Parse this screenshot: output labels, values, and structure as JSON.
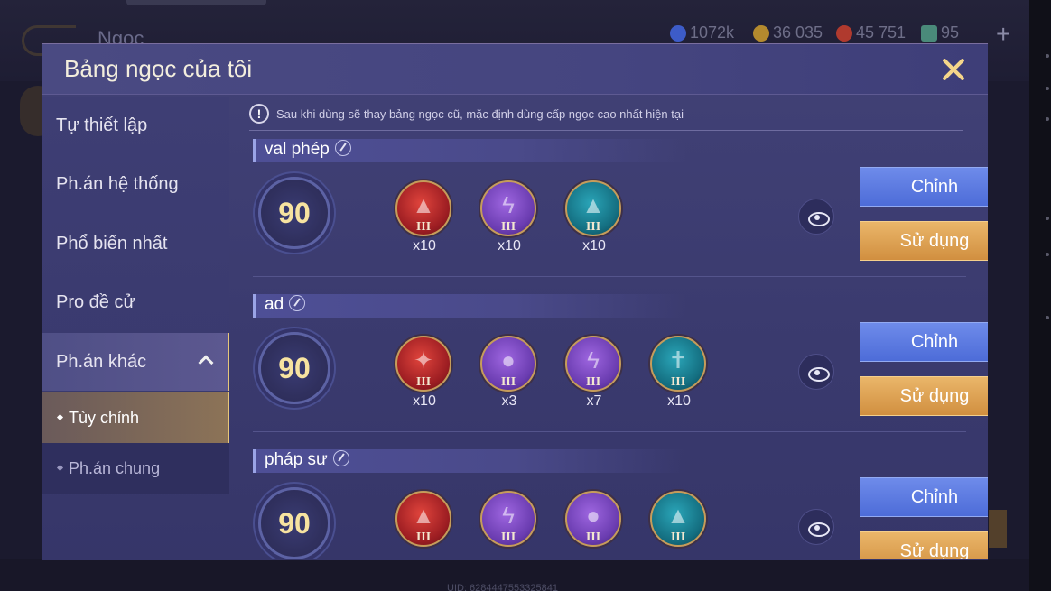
{
  "background": {
    "title": "Ngọc",
    "resources": [
      {
        "icon": "diamond-icon",
        "value": "1072k",
        "color": "#3d5cc8"
      },
      {
        "icon": "gold-coin-icon",
        "value": "36 035",
        "color": "#b48a2e"
      },
      {
        "icon": "ruby-icon",
        "value": "45 751",
        "color": "#b03a2e"
      },
      {
        "icon": "voucher-icon",
        "value": "95",
        "color": "#4a8a7a"
      }
    ],
    "plus_label": "+",
    "uid": "UID: 6284447553325841"
  },
  "modal": {
    "title": "Bảng ngọc của tôi"
  },
  "sidebar": {
    "items": [
      {
        "label": "Tự thiết lập"
      },
      {
        "label": "Ph.án hệ thống"
      },
      {
        "label": "Phổ biến nhất"
      },
      {
        "label": "Pro đề cử"
      },
      {
        "label": "Ph.án khác"
      }
    ],
    "sub_items": [
      {
        "label": "Tùy chỉnh"
      },
      {
        "label": "Ph.án chung"
      }
    ]
  },
  "notice": {
    "text": "Sau khi dùng sẽ thay bảng ngọc cũ, mặc định dùng cấp ngọc cao nhất hiện tại"
  },
  "sets": [
    {
      "name": "val phép",
      "level": "90",
      "gems": [
        {
          "color": "red",
          "glyph": "▲",
          "tier": "III",
          "count": "x10"
        },
        {
          "color": "purple",
          "glyph": "ϟ",
          "tier": "III",
          "count": "x10"
        },
        {
          "color": "teal",
          "glyph": "▲",
          "tier": "III",
          "count": "x10"
        }
      ],
      "edit_label": "Chỉnh",
      "use_label": "Sử dụng"
    },
    {
      "name": "ad",
      "level": "90",
      "gems": [
        {
          "color": "red",
          "glyph": "✦",
          "tier": "III",
          "count": "x10"
        },
        {
          "color": "purple",
          "glyph": "●",
          "tier": "III",
          "count": "x3"
        },
        {
          "color": "purple",
          "glyph": "ϟ",
          "tier": "III",
          "count": "x7"
        },
        {
          "color": "teal",
          "glyph": "✝",
          "tier": "III",
          "count": "x10"
        }
      ],
      "edit_label": "Chỉnh",
      "use_label": "Sử dụng"
    },
    {
      "name": "pháp sư",
      "level": "90",
      "gems": [
        {
          "color": "red",
          "glyph": "▲",
          "tier": "III",
          "count": ""
        },
        {
          "color": "purple",
          "glyph": "ϟ",
          "tier": "III",
          "count": ""
        },
        {
          "color": "purple",
          "glyph": "●",
          "tier": "III",
          "count": ""
        },
        {
          "color": "teal",
          "glyph": "▲",
          "tier": "III",
          "count": ""
        }
      ],
      "edit_label": "Chỉnh",
      "use_label": "Sử dụng"
    }
  ],
  "colors": {
    "accent_gold": "#e7c77a",
    "edit_button": "#5a78e0",
    "use_button": "#e0a458",
    "modal_bg": "#3d3d72"
  }
}
